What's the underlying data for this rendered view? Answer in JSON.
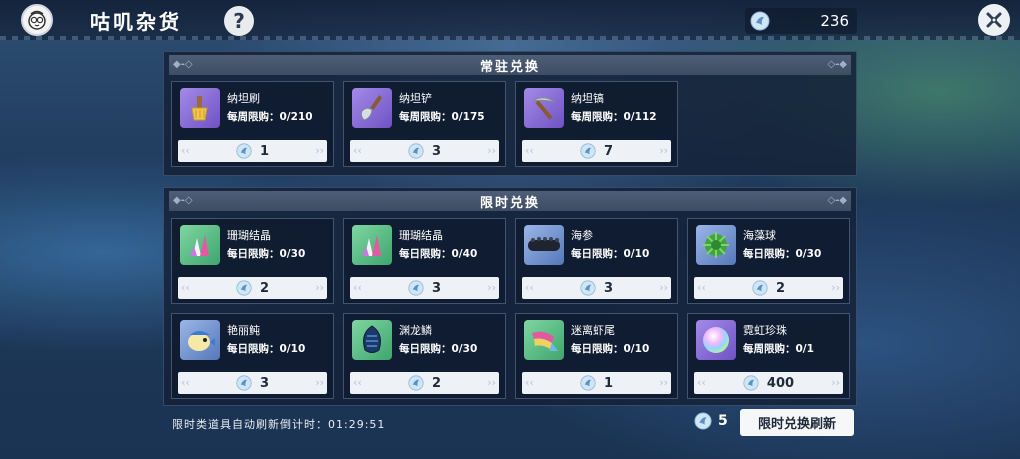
{
  "app": {
    "title": "咕叽杂货",
    "help_label": "?",
    "currency_amount": "236"
  },
  "colors": {
    "panel_header": "#4e5e76",
    "price_bar": "#eef1f5",
    "icon_purple": "#6f52c4",
    "icon_green": "#3fa56e"
  },
  "regular": {
    "title": "常驻兑换",
    "items": [
      {
        "name": "纳坦刷",
        "limit": "每周限购：0/210",
        "price": "1",
        "icon": "brush-icon"
      },
      {
        "name": "纳坦铲",
        "limit": "每周限购：0/175",
        "price": "3",
        "icon": "shovel-icon"
      },
      {
        "name": "纳坦镐",
        "limit": "每周限购：0/112",
        "price": "7",
        "icon": "pickaxe-icon"
      }
    ]
  },
  "limited": {
    "title": "限时兑换",
    "items": [
      {
        "name": "珊瑚结晶",
        "limit": "每日限购：0/30",
        "price": "2",
        "icon": "coral-crystal-icon"
      },
      {
        "name": "珊瑚结晶",
        "limit": "每日限购：0/40",
        "price": "3",
        "icon": "coral-crystal-icon"
      },
      {
        "name": "海参",
        "limit": "每日限购：0/10",
        "price": "3",
        "icon": "sea-cucumber-icon"
      },
      {
        "name": "海藻球",
        "limit": "每日限购：0/30",
        "price": "2",
        "icon": "seaweed-ball-icon"
      },
      {
        "name": "艳丽鲀",
        "limit": "每日限购：0/10",
        "price": "3",
        "icon": "pufferfish-icon"
      },
      {
        "name": "渊龙鳞",
        "limit": "每日限购：0/30",
        "price": "2",
        "icon": "dragon-scale-icon"
      },
      {
        "name": "迷离虾尾",
        "limit": "每日限购：0/10",
        "price": "1",
        "icon": "shrimp-tail-icon"
      },
      {
        "name": "霓虹珍珠",
        "limit": "每周限购：0/1",
        "price": "400",
        "icon": "neon-pearl-icon"
      }
    ]
  },
  "footer": {
    "timer_text": "限时类道具自动刷新倒计时：01:29:51",
    "refresh_cost": "5",
    "refresh_button": "限时兑换刷新"
  }
}
